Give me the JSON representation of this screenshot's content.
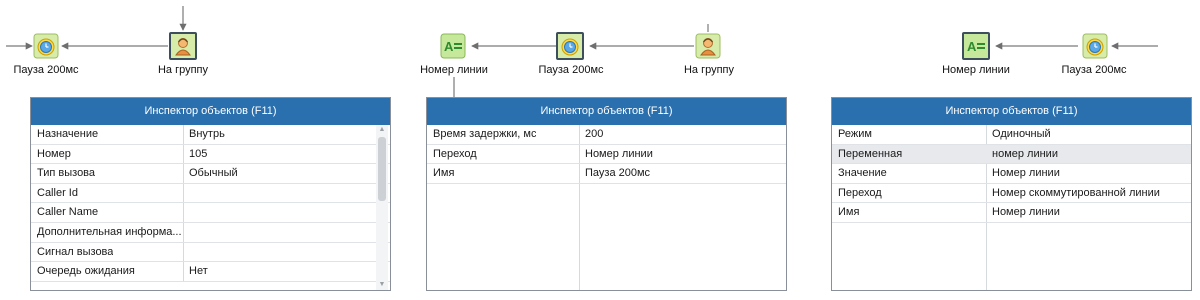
{
  "colors": {
    "header": "#2a6fae",
    "connector": "#7a7a7a",
    "selected_border": "#3d4f5c"
  },
  "nodes": {
    "pause1": {
      "label": "Пауза 200мс",
      "icon": "clock-icon"
    },
    "group1": {
      "label": "На группу",
      "icon": "person-icon"
    },
    "line1": {
      "label": "Номер линии",
      "icon": "assign-icon"
    },
    "pause2": {
      "label": "Пауза 200мс",
      "icon": "clock-icon"
    },
    "group2": {
      "label": "На группу",
      "icon": "person-icon"
    },
    "line2": {
      "label": "Номер линии",
      "icon": "assign-icon"
    },
    "pause3": {
      "label": "Пауза 200мс",
      "icon": "clock-icon"
    }
  },
  "inspectors": [
    {
      "title": "Инспектор объектов (F11)",
      "rows": [
        {
          "key": "Назначение",
          "value": "Внутрь"
        },
        {
          "key": "Номер",
          "value": "105"
        },
        {
          "key": "Тип вызова",
          "value": "Обычный"
        },
        {
          "key": "Caller Id",
          "value": ""
        },
        {
          "key": "Caller Name",
          "value": ""
        },
        {
          "key": "Дополнительная информа...",
          "value": ""
        },
        {
          "key": "Сигнал вызова",
          "value": ""
        },
        {
          "key": "Очередь ожидания",
          "value": "Нет"
        }
      ]
    },
    {
      "title": "Инспектор объектов (F11)",
      "rows": [
        {
          "key": "Время задержки, мс",
          "value": "200"
        },
        {
          "key": "Переход",
          "value": "Номер линии"
        },
        {
          "key": "Имя",
          "value": "Пауза 200мс"
        }
      ]
    },
    {
      "title": "Инспектор объектов (F11)",
      "rows": [
        {
          "key": "Режим",
          "value": "Одиночный"
        },
        {
          "key": "Переменная",
          "value": "номер линии"
        },
        {
          "key": "Значение",
          "value": "Номер линии"
        },
        {
          "key": "Переход",
          "value": "Номер скоммутированной линии"
        },
        {
          "key": "Имя",
          "value": "Номер линии"
        }
      ]
    }
  ]
}
